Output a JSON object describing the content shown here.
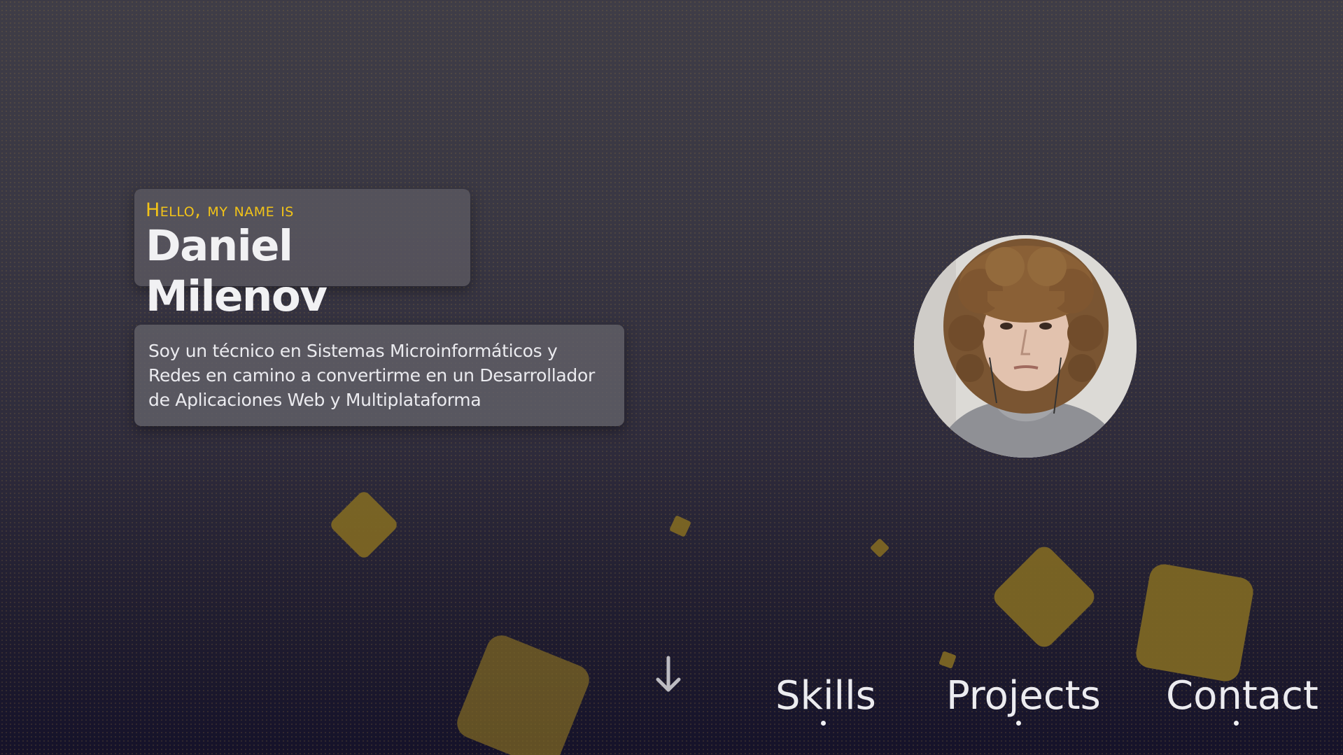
{
  "hero": {
    "greeting": "Hello, my name is",
    "name": "Daniel Milenov",
    "about": "Soy un técnico en Sistemas Microinformáticos y Redes en camino a convertirme en un Desarrollador de Aplicaciones Web y Multiplataforma",
    "avatar_icon": "profile-photo"
  },
  "nav": {
    "items": [
      {
        "label": "Skills"
      },
      {
        "label": "Projects"
      },
      {
        "label": "Contact"
      }
    ]
  },
  "scroll_indicator": {
    "icon": "arrow-down-icon"
  },
  "colors": {
    "accent": "#f2c318",
    "diamond": "#7c6624",
    "card_bg": "#5a5860",
    "page_bg_top": "#3f3d47",
    "page_bg_bottom": "#15122a",
    "text": "#f1f1f3"
  }
}
